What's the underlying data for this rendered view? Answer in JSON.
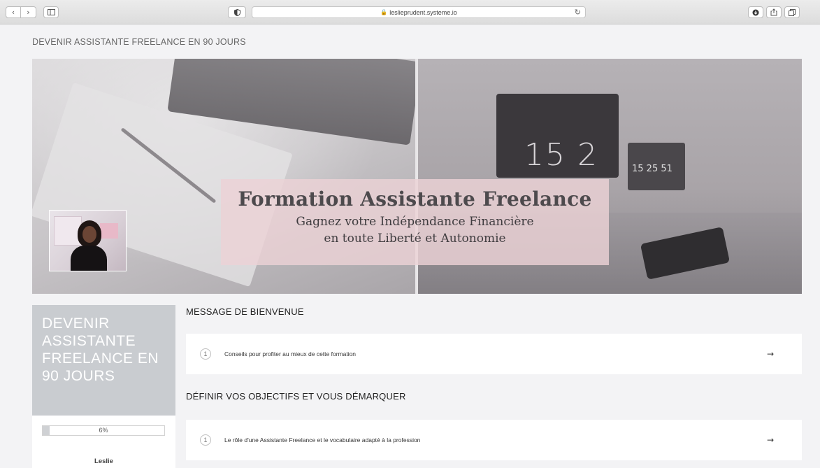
{
  "browser": {
    "url": "leslieprudent.systeme.io",
    "icons": [
      "chevron-left-icon",
      "chevron-right-icon",
      "sidebar-icon",
      "shield-icon",
      "lock-icon",
      "reload-icon",
      "download-icon",
      "share-icon",
      "tabs-icon"
    ]
  },
  "course": {
    "header": "DEVENIR ASSISTANTE FREELANCE EN 90 JOURS"
  },
  "hero": {
    "title": "Formation Assistante Freelance",
    "subtitle_line1": "Gagnez votre Indépendance Financière",
    "subtitle_line2": "en toute Liberté et Autonomie",
    "clock_large": "15 2",
    "clock_small": "15 25 51"
  },
  "sidebar": {
    "title": "DEVENIR ASSISTANTE FREELANCE EN 90 JOURS",
    "progress_label": "6%",
    "progress_value": 0.06,
    "student_name": "Leslie"
  },
  "modules": [
    {
      "title": "MESSAGE DE BIENVENUE",
      "lessons": [
        {
          "number": "1",
          "label": "Conseils pour profiter au mieux de cette formation",
          "arrow": "→"
        }
      ]
    },
    {
      "title": "DÉFINIR VOS OBJECTIFS ET VOUS DÉMARQUER",
      "lessons": [
        {
          "number": "1",
          "label": "Le rôle d'une Assistante Freelance et le vocabulaire adapté à la profession",
          "arrow": "→"
        }
      ]
    }
  ]
}
